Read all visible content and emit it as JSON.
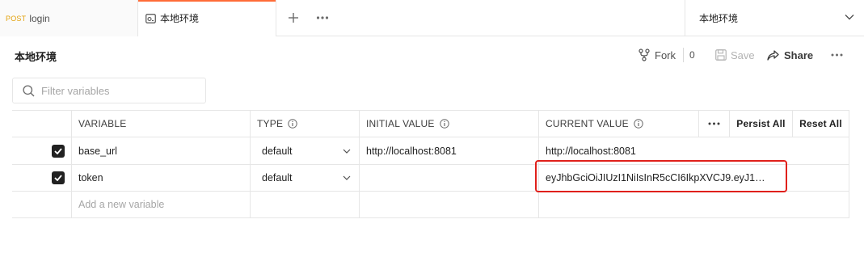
{
  "tabs": {
    "login": {
      "method": "POST",
      "label": "login"
    },
    "env": {
      "label": "本地环境"
    },
    "add_icon": "plus-icon",
    "more_icon": "ellipsis-icon"
  },
  "environment_selector": {
    "value": "本地环境",
    "icon": "chevron-down-icon"
  },
  "header": {
    "title": "本地环境",
    "fork_label": "Fork",
    "fork_count": "0",
    "save_label": "Save",
    "share_label": "Share"
  },
  "filter": {
    "placeholder": "Filter variables"
  },
  "table": {
    "columns": {
      "variable": "VARIABLE",
      "type": "TYPE",
      "initial_value": "INITIAL VALUE",
      "current_value": "CURRENT VALUE",
      "persist_all": "Persist All",
      "reset_all": "Reset All"
    },
    "rows": [
      {
        "checked": true,
        "variable": "base_url",
        "type": "default",
        "initial_value": "http://localhost:8081",
        "current_value": "http://localhost:8081"
      },
      {
        "checked": true,
        "variable": "token",
        "type": "default",
        "initial_value": "",
        "current_value": "eyJhbGciOiJIUzI1NiIsInR5cCI6IkpXVCJ9.eyJ1c..."
      }
    ],
    "new_variable_placeholder": "Add a new variable"
  },
  "colors": {
    "accent": "#ff6c37",
    "post_method": "#e3a20d",
    "highlight": "#e0201b"
  }
}
